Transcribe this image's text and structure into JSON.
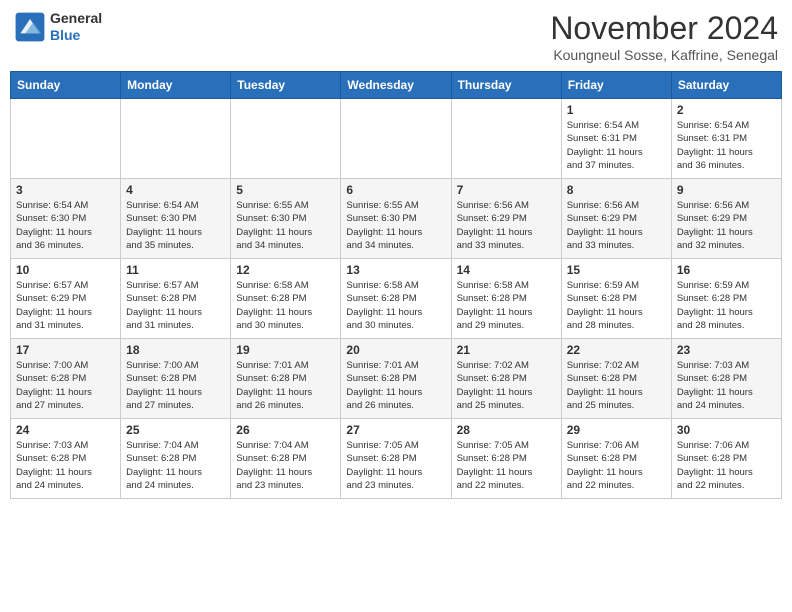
{
  "header": {
    "logo_line1": "General",
    "logo_line2": "Blue",
    "month": "November 2024",
    "location": "Koungneul Sosse, Kaffrine, Senegal"
  },
  "weekdays": [
    "Sunday",
    "Monday",
    "Tuesday",
    "Wednesday",
    "Thursday",
    "Friday",
    "Saturday"
  ],
  "weeks": [
    [
      {
        "day": "",
        "info": ""
      },
      {
        "day": "",
        "info": ""
      },
      {
        "day": "",
        "info": ""
      },
      {
        "day": "",
        "info": ""
      },
      {
        "day": "",
        "info": ""
      },
      {
        "day": "1",
        "info": "Sunrise: 6:54 AM\nSunset: 6:31 PM\nDaylight: 11 hours\nand 37 minutes."
      },
      {
        "day": "2",
        "info": "Sunrise: 6:54 AM\nSunset: 6:31 PM\nDaylight: 11 hours\nand 36 minutes."
      }
    ],
    [
      {
        "day": "3",
        "info": "Sunrise: 6:54 AM\nSunset: 6:30 PM\nDaylight: 11 hours\nand 36 minutes."
      },
      {
        "day": "4",
        "info": "Sunrise: 6:54 AM\nSunset: 6:30 PM\nDaylight: 11 hours\nand 35 minutes."
      },
      {
        "day": "5",
        "info": "Sunrise: 6:55 AM\nSunset: 6:30 PM\nDaylight: 11 hours\nand 34 minutes."
      },
      {
        "day": "6",
        "info": "Sunrise: 6:55 AM\nSunset: 6:30 PM\nDaylight: 11 hours\nand 34 minutes."
      },
      {
        "day": "7",
        "info": "Sunrise: 6:56 AM\nSunset: 6:29 PM\nDaylight: 11 hours\nand 33 minutes."
      },
      {
        "day": "8",
        "info": "Sunrise: 6:56 AM\nSunset: 6:29 PM\nDaylight: 11 hours\nand 33 minutes."
      },
      {
        "day": "9",
        "info": "Sunrise: 6:56 AM\nSunset: 6:29 PM\nDaylight: 11 hours\nand 32 minutes."
      }
    ],
    [
      {
        "day": "10",
        "info": "Sunrise: 6:57 AM\nSunset: 6:29 PM\nDaylight: 11 hours\nand 31 minutes."
      },
      {
        "day": "11",
        "info": "Sunrise: 6:57 AM\nSunset: 6:28 PM\nDaylight: 11 hours\nand 31 minutes."
      },
      {
        "day": "12",
        "info": "Sunrise: 6:58 AM\nSunset: 6:28 PM\nDaylight: 11 hours\nand 30 minutes."
      },
      {
        "day": "13",
        "info": "Sunrise: 6:58 AM\nSunset: 6:28 PM\nDaylight: 11 hours\nand 30 minutes."
      },
      {
        "day": "14",
        "info": "Sunrise: 6:58 AM\nSunset: 6:28 PM\nDaylight: 11 hours\nand 29 minutes."
      },
      {
        "day": "15",
        "info": "Sunrise: 6:59 AM\nSunset: 6:28 PM\nDaylight: 11 hours\nand 28 minutes."
      },
      {
        "day": "16",
        "info": "Sunrise: 6:59 AM\nSunset: 6:28 PM\nDaylight: 11 hours\nand 28 minutes."
      }
    ],
    [
      {
        "day": "17",
        "info": "Sunrise: 7:00 AM\nSunset: 6:28 PM\nDaylight: 11 hours\nand 27 minutes."
      },
      {
        "day": "18",
        "info": "Sunrise: 7:00 AM\nSunset: 6:28 PM\nDaylight: 11 hours\nand 27 minutes."
      },
      {
        "day": "19",
        "info": "Sunrise: 7:01 AM\nSunset: 6:28 PM\nDaylight: 11 hours\nand 26 minutes."
      },
      {
        "day": "20",
        "info": "Sunrise: 7:01 AM\nSunset: 6:28 PM\nDaylight: 11 hours\nand 26 minutes."
      },
      {
        "day": "21",
        "info": "Sunrise: 7:02 AM\nSunset: 6:28 PM\nDaylight: 11 hours\nand 25 minutes."
      },
      {
        "day": "22",
        "info": "Sunrise: 7:02 AM\nSunset: 6:28 PM\nDaylight: 11 hours\nand 25 minutes."
      },
      {
        "day": "23",
        "info": "Sunrise: 7:03 AM\nSunset: 6:28 PM\nDaylight: 11 hours\nand 24 minutes."
      }
    ],
    [
      {
        "day": "24",
        "info": "Sunrise: 7:03 AM\nSunset: 6:28 PM\nDaylight: 11 hours\nand 24 minutes."
      },
      {
        "day": "25",
        "info": "Sunrise: 7:04 AM\nSunset: 6:28 PM\nDaylight: 11 hours\nand 24 minutes."
      },
      {
        "day": "26",
        "info": "Sunrise: 7:04 AM\nSunset: 6:28 PM\nDaylight: 11 hours\nand 23 minutes."
      },
      {
        "day": "27",
        "info": "Sunrise: 7:05 AM\nSunset: 6:28 PM\nDaylight: 11 hours\nand 23 minutes."
      },
      {
        "day": "28",
        "info": "Sunrise: 7:05 AM\nSunset: 6:28 PM\nDaylight: 11 hours\nand 22 minutes."
      },
      {
        "day": "29",
        "info": "Sunrise: 7:06 AM\nSunset: 6:28 PM\nDaylight: 11 hours\nand 22 minutes."
      },
      {
        "day": "30",
        "info": "Sunrise: 7:06 AM\nSunset: 6:28 PM\nDaylight: 11 hours\nand 22 minutes."
      }
    ]
  ]
}
